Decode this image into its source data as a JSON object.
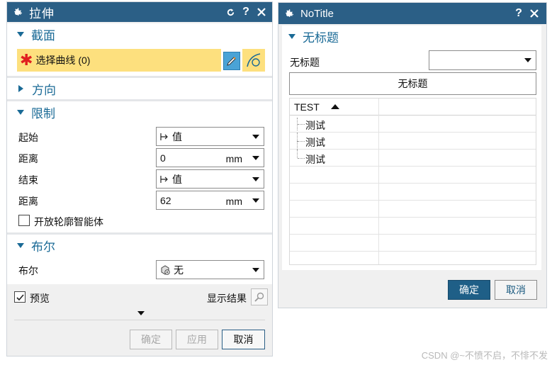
{
  "left_dialog": {
    "title": "拉伸",
    "sections": {
      "section": "截面",
      "direction": "方向",
      "limits": "限制",
      "boolean": "布尔"
    },
    "select_curve": "选择曲线 (0)",
    "limits": {
      "start_label": "起始",
      "start_value": "值",
      "start_dist_label": "距离",
      "start_dist_value": "0",
      "start_dist_unit": "mm",
      "end_label": "结束",
      "end_value": "值",
      "end_dist_label": "距离",
      "end_dist_value": "62",
      "end_dist_unit": "mm",
      "open_profile": "开放轮廓智能体"
    },
    "boolean": {
      "label": "布尔",
      "value": "无"
    },
    "preview_label": "预览",
    "show_result": "显示结果",
    "buttons": {
      "ok": "确定",
      "apply": "应用",
      "cancel": "取消"
    }
  },
  "right_dialog": {
    "title": "NoTitle",
    "section": "无标题",
    "field_label": "无标题",
    "field_value": "",
    "big_button": "无标题",
    "table": {
      "column": "TEST",
      "rows": [
        "测试",
        "测试",
        "测试"
      ]
    },
    "buttons": {
      "ok": "确定",
      "cancel": "取消"
    }
  },
  "watermark": "CSDN @~不愤不启，不悱不发",
  "colors": {
    "titlebar": "#2b5f86",
    "accent": "#1a6a96",
    "selection": "#fde07e",
    "required": "#e02020"
  }
}
